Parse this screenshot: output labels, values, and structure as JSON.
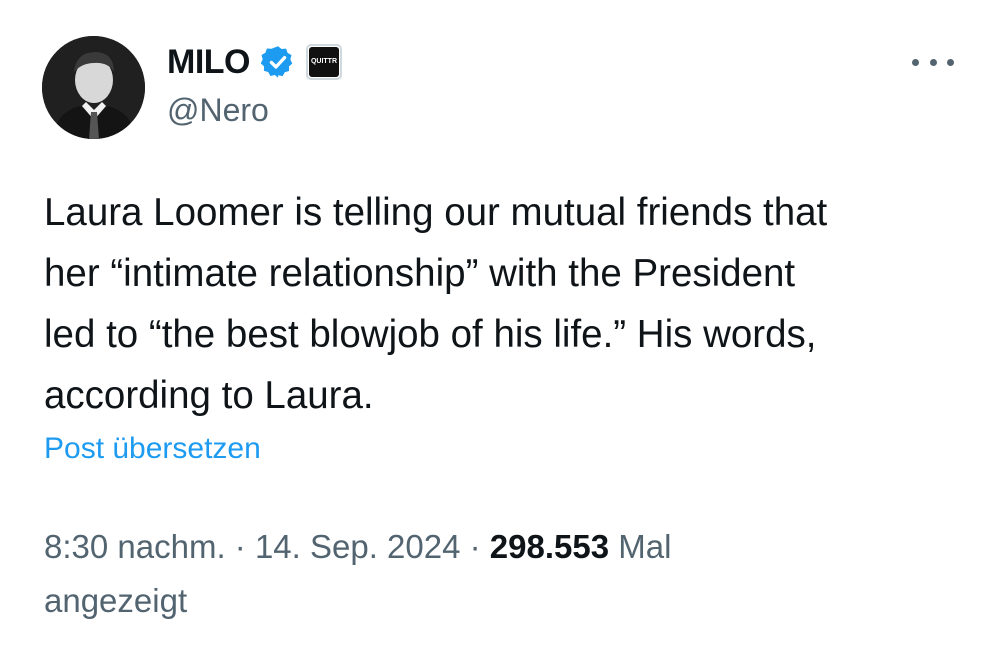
{
  "author": {
    "display_name": "MILO",
    "handle": "@Nero",
    "verified_icon": "verified-checkmark-icon",
    "affiliate_badge_text": "QUITTR",
    "verified_color": "#1d9bf0"
  },
  "menu": {
    "icon": "more-options-icon"
  },
  "tweet": {
    "text": "Laura Loomer is telling our mutual friends that\nher “intimate relationship” with the President\nled to “the best blowjob of his life.” His words,\naccording to Laura."
  },
  "translate": {
    "label": "Post übersetzen"
  },
  "meta": {
    "time": "8:30 nachm.",
    "separator": " · ",
    "date": "14. Sep. 2024",
    "views_count": "298.553",
    "views_label_1": "Mal",
    "views_label_2": "angezeigt"
  },
  "colors": {
    "text_primary": "#0f1419",
    "text_secondary": "#536471",
    "link": "#1d9bf0"
  }
}
